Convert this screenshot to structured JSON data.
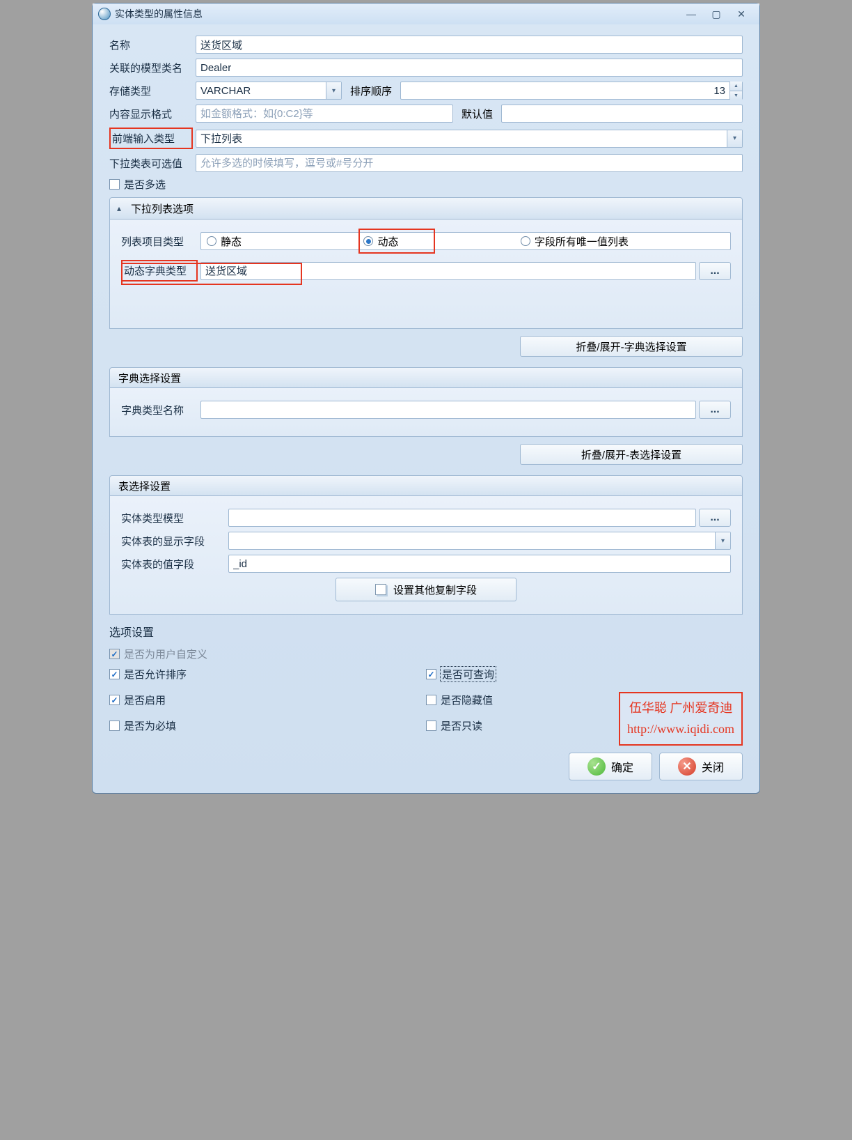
{
  "window_title": "实体类型的属性信息",
  "fields": {
    "name_label": "名称",
    "name_value": "送货区域",
    "model_label": "关联的模型类名",
    "model_value": "Dealer",
    "storage_label": "存储类型",
    "storage_value": "VARCHAR",
    "sort_label": "排序顺序",
    "sort_value": "13",
    "display_fmt_label": "内容显示格式",
    "display_fmt_placeholder": "如金额格式：如{0:C2}等",
    "default_label": "默认值",
    "default_value": "",
    "input_type_label": "前端输入类型",
    "input_type_value": "下拉列表",
    "dropdown_values_label": "下拉类表可选值",
    "dropdown_values_placeholder": "允许多选的时候填写，逗号或#号分开",
    "multiselect_label": "是否多选"
  },
  "dropdown_section": {
    "title": "下拉列表选项",
    "item_type_label": "列表项目类型",
    "radio_static": "静态",
    "radio_dynamic": "动态",
    "radio_unique": "字段所有唯一值列表",
    "dict_type_label": "动态字典类型",
    "dict_type_value": "送货区域"
  },
  "toggle_dict": "折叠/展开-字典选择设置",
  "dict_section": {
    "title": "字典选择设置",
    "name_label": "字典类型名称",
    "name_value": ""
  },
  "toggle_table": "折叠/展开-表选择设置",
  "table_section": {
    "title": "表选择设置",
    "model_label": "实体类型模型",
    "model_value": "",
    "display_field_label": "实体表的显示字段",
    "display_field_value": "",
    "value_field_label": "实体表的值字段",
    "value_field_value": "_id",
    "copy_button": "设置其他复制字段"
  },
  "options": {
    "title": "选项设置",
    "user_defined": "是否为用户自定义",
    "sortable": "是否允许排序",
    "queryable": "是否可查询",
    "enabled": "是否启用",
    "hidden": "是否隐藏值",
    "required": "是否为必填",
    "readonly": "是否只读"
  },
  "footer": {
    "ok": "确定",
    "close": "关闭"
  },
  "watermark": {
    "line1": "伍华聪 广州爱奇迪",
    "line2": "http://www.iqidi.com"
  }
}
